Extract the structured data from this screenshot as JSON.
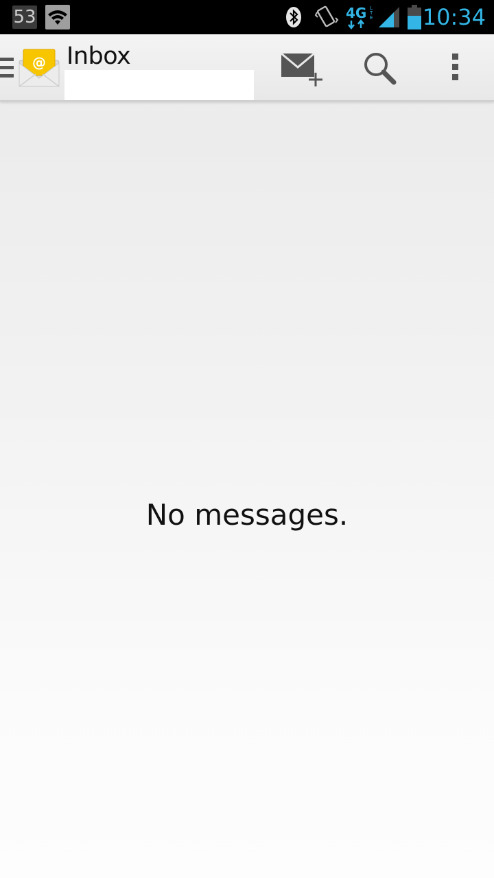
{
  "status_bar": {
    "notification_count": "53",
    "time": "10:34",
    "network_type": "4G LTE",
    "icons": [
      "notification-count",
      "wifi-icon",
      "bluetooth-icon",
      "vibrate-icon",
      "4g-lte-icon",
      "signal-icon",
      "battery-icon"
    ],
    "time_color": "#33b5e5"
  },
  "action_bar": {
    "title": "Inbox",
    "account_value": "",
    "actions": [
      {
        "name": "compose",
        "icon": "compose-mail-icon"
      },
      {
        "name": "search",
        "icon": "search-icon"
      },
      {
        "name": "overflow",
        "icon": "overflow-menu-icon"
      }
    ]
  },
  "main": {
    "empty_message": "No messages."
  },
  "colors": {
    "accent": "#33b5e5",
    "app_icon": "#f7c600"
  }
}
